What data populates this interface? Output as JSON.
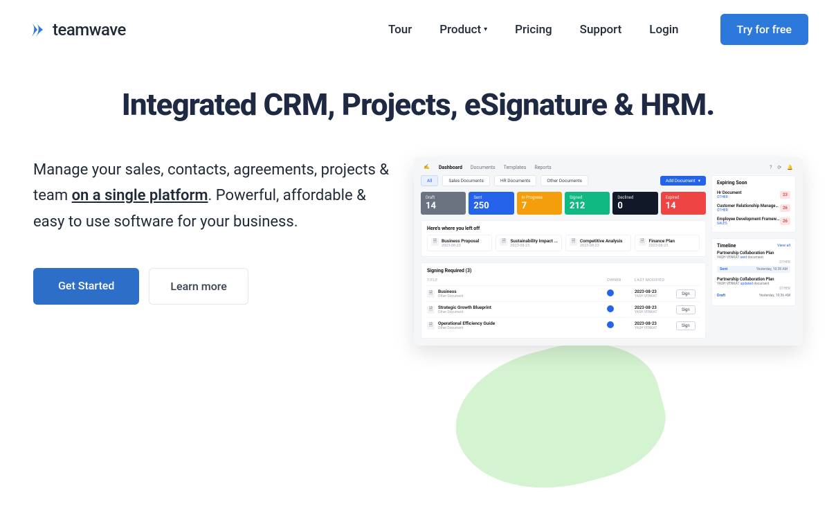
{
  "brand": {
    "name": "teamwave"
  },
  "nav": {
    "tour": "Tour",
    "product": "Product",
    "pricing": "Pricing",
    "support": "Support",
    "login": "Login",
    "cta": "Try for free"
  },
  "hero": {
    "title": "Integrated CRM, Projects, eSignature & HRM.",
    "text1": "Manage your sales, contacts, agreements, projects & team ",
    "text_underline": "on a single platform",
    "text2": ". Powerful, affordable & easy to use software for your business.",
    "btn_primary": "Get Started",
    "btn_secondary": "Learn more"
  },
  "dashboard": {
    "tabs": {
      "dashboard": "Dashboard",
      "documents": "Documents",
      "templates": "Templates",
      "reports": "Reports"
    },
    "filters": {
      "all": "All",
      "sales": "Sales Documents",
      "hr": "HR Documents",
      "other": "Other Documents"
    },
    "add_doc": "Add Document",
    "stats": [
      {
        "label": "Draft",
        "value": "14",
        "color": "#6b7280"
      },
      {
        "label": "Sent",
        "value": "250",
        "color": "#2563eb"
      },
      {
        "label": "In Progress",
        "value": "7",
        "color": "#f59e0b"
      },
      {
        "label": "Signed",
        "value": "212",
        "color": "#10b981"
      },
      {
        "label": "Declined",
        "value": "0",
        "color": "#111827"
      },
      {
        "label": "Expired",
        "value": "14",
        "color": "#ef4444"
      }
    ],
    "left_off_title": "Here's where you left off",
    "left_off": [
      {
        "title": "Business Proposal",
        "date": "2023-08-23"
      },
      {
        "title": "Sustainability Impact ...",
        "date": "2023-08-23"
      },
      {
        "title": "Competitive Analysis",
        "date": "2023-08-23"
      },
      {
        "title": "Finance Plan",
        "date": "2023-08-23"
      }
    ],
    "signing_title": "Signing Required (3)",
    "table_headers": {
      "title": "TITLE",
      "owner": "OWNER",
      "modified": "LAST MODIFIED"
    },
    "signing_rows": [
      {
        "title": "Business",
        "sub": "Other Document",
        "date": "2023-08-23",
        "owner_sub": "YASH VENKAT"
      },
      {
        "title": "Strategic Growth Blueprint",
        "sub": "Other Document",
        "date": "2023-08-23",
        "owner_sub": "YASH VENKAT"
      },
      {
        "title": "Operational Efficiency Guide",
        "sub": "Other Document",
        "date": "2023-08-23",
        "owner_sub": "YASH VENKAT"
      }
    ],
    "sign_btn": "Sign",
    "expiring_title": "Expiring Soon",
    "expiring": [
      {
        "name": "Hr Document",
        "sub": "OTHER",
        "badge": "23"
      },
      {
        "name": "Customer Relationship Manageme...",
        "sub": "OTHER",
        "badge": "26"
      },
      {
        "name": "Employee Development Framework",
        "sub": "SALES",
        "badge": "26"
      }
    ],
    "timeline_title": "Timeline",
    "viewall": "View all",
    "timeline": [
      {
        "title": "Partnership Collaboration Plan",
        "who": "YASH VENKAT",
        "action": "sent",
        "obj": "document",
        "tag": "OTHER",
        "status": "Sent",
        "time": "Yesterday, 10:38 AM",
        "highlight": true
      },
      {
        "title": "Partnership Collaboration Plan",
        "who": "YASH VENKAT",
        "action": "updated",
        "obj": "document",
        "tag": "OTHER",
        "status": "Draft",
        "time": "Yesterday, 10:36 AM",
        "highlight": false
      }
    ]
  }
}
